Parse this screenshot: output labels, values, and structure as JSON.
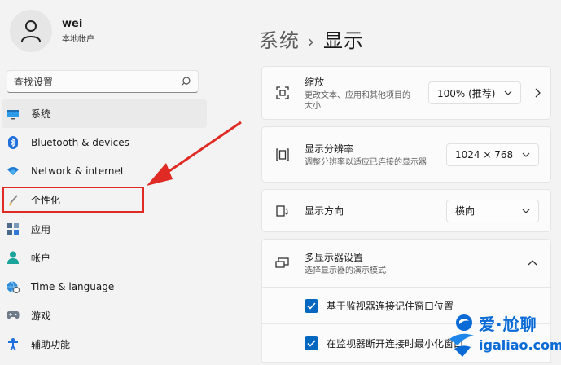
{
  "user": {
    "name": "wei",
    "account_type": "本地帐户"
  },
  "search": {
    "placeholder": "查找设置"
  },
  "nav": [
    {
      "label": "系统",
      "icon": "monitor-icon",
      "active": true
    },
    {
      "label": "Bluetooth & devices",
      "icon": "bluetooth-icon"
    },
    {
      "label": "Network & internet",
      "icon": "wifi-icon"
    },
    {
      "label": "个性化",
      "icon": "brush-icon"
    },
    {
      "label": "应用",
      "icon": "apps-icon"
    },
    {
      "label": "帐户",
      "icon": "person-icon"
    },
    {
      "label": "Time & language",
      "icon": "globe-clock-icon"
    },
    {
      "label": "游戏",
      "icon": "gamepad-icon"
    },
    {
      "label": "辅助功能",
      "icon": "accessibility-icon"
    }
  ],
  "breadcrumb": {
    "parent": "系统",
    "separator": "›",
    "current": "显示"
  },
  "settings": {
    "scale": {
      "title": "缩放",
      "subtitle": "更改文本、应用和其他项目的大小",
      "value": "100% (推荐)"
    },
    "resolution": {
      "title": "显示分辨率",
      "subtitle": "调整分辨率以适应已连接的显示器",
      "value": "1024 × 768"
    },
    "orientation": {
      "title": "显示方向",
      "value": "横向"
    },
    "multi_display": {
      "title": "多显示器设置",
      "subtitle": "选择显示器的演示模式"
    },
    "remember_windows": {
      "label": "基于监视器连接记住窗口位置",
      "checked": true
    },
    "minimize_windows": {
      "label": "在监视器断开连接时最小化窗口",
      "checked": true
    }
  },
  "watermark": {
    "text": "爱·尬聊",
    "url": "igaliao.com"
  },
  "colors": {
    "accent": "#0067c0",
    "highlight": "#e02a24",
    "watermark": "#0a6ad6"
  }
}
